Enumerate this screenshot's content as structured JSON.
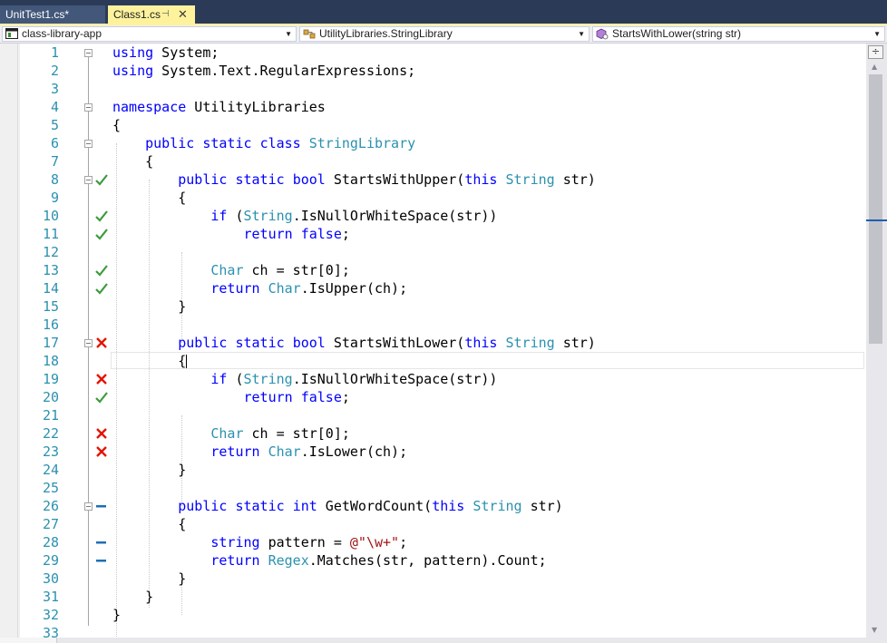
{
  "tabs": [
    {
      "label": "UnitTest1.cs*",
      "active": false
    },
    {
      "label": "Class1.cs",
      "active": true,
      "pin": "⊣",
      "close": "✕"
    }
  ],
  "nav": {
    "project": "class-library-app",
    "type": "UtilityLibraries.StringLibrary",
    "member": "StartsWithLower(string str)"
  },
  "colors": {
    "keyword": "#0000ff",
    "type": "#2b91af",
    "string": "#a31515",
    "line_number": "#2b91af",
    "covered": "#3c9b3c",
    "not_covered": "#e51400",
    "no_coverage": "#1e6fb4",
    "active_tab": "#fff29d"
  },
  "scroll": {
    "split": "÷"
  },
  "lines": [
    {
      "n": "1",
      "code": "using System;",
      "fold": true,
      "cov": "none"
    },
    {
      "n": "2",
      "code": "using System.Text.RegularExpressions;",
      "fold": false,
      "cov": "none"
    },
    {
      "n": "3",
      "code": "",
      "fold": false,
      "cov": "none"
    },
    {
      "n": "4",
      "code": "namespace UtilityLibraries",
      "fold": true,
      "cov": "none"
    },
    {
      "n": "5",
      "code": "{",
      "fold": false,
      "cov": "none"
    },
    {
      "n": "6",
      "code": "    public static class StringLibrary",
      "fold": true,
      "cov": "none"
    },
    {
      "n": "7",
      "code": "    {",
      "fold": false,
      "cov": "none"
    },
    {
      "n": "8",
      "code": "        public static bool StartsWithUpper(this String str)",
      "fold": true,
      "cov": "covered"
    },
    {
      "n": "9",
      "code": "        {",
      "fold": false,
      "cov": "none"
    },
    {
      "n": "10",
      "code": "            if (String.IsNullOrWhiteSpace(str))",
      "fold": false,
      "cov": "covered"
    },
    {
      "n": "11",
      "code": "                return false;",
      "fold": false,
      "cov": "covered"
    },
    {
      "n": "12",
      "code": "",
      "fold": false,
      "cov": "none"
    },
    {
      "n": "13",
      "code": "            Char ch = str[0];",
      "fold": false,
      "cov": "covered"
    },
    {
      "n": "14",
      "code": "            return Char.IsUpper(ch);",
      "fold": false,
      "cov": "covered"
    },
    {
      "n": "15",
      "code": "        }",
      "fold": false,
      "cov": "none"
    },
    {
      "n": "16",
      "code": "",
      "fold": false,
      "cov": "none"
    },
    {
      "n": "17",
      "code": "        public static bool StartsWithLower(this String str)",
      "fold": true,
      "cov": "not-covered"
    },
    {
      "n": "18",
      "code": "        {",
      "fold": false,
      "cov": "none"
    },
    {
      "n": "19",
      "code": "            if (String.IsNullOrWhiteSpace(str))",
      "fold": false,
      "cov": "not-covered"
    },
    {
      "n": "20",
      "code": "                return false;",
      "fold": false,
      "cov": "covered"
    },
    {
      "n": "21",
      "code": "",
      "fold": false,
      "cov": "none"
    },
    {
      "n": "22",
      "code": "            Char ch = str[0];",
      "fold": false,
      "cov": "not-covered"
    },
    {
      "n": "23",
      "code": "            return Char.IsLower(ch);",
      "fold": false,
      "cov": "not-covered"
    },
    {
      "n": "24",
      "code": "        }",
      "fold": false,
      "cov": "none"
    },
    {
      "n": "25",
      "code": "",
      "fold": false,
      "cov": "none"
    },
    {
      "n": "26",
      "code": "        public static int GetWordCount(this String str)",
      "fold": true,
      "cov": "no-coverage"
    },
    {
      "n": "27",
      "code": "        {",
      "fold": false,
      "cov": "none"
    },
    {
      "n": "28",
      "code": "            string pattern = @\"\\w+\";",
      "fold": false,
      "cov": "no-coverage"
    },
    {
      "n": "29",
      "code": "            return Regex.Matches(str, pattern).Count;",
      "fold": false,
      "cov": "no-coverage"
    },
    {
      "n": "30",
      "code": "        }",
      "fold": false,
      "cov": "none"
    },
    {
      "n": "31",
      "code": "    }",
      "fold": false,
      "cov": "none"
    },
    {
      "n": "32",
      "code": "}",
      "fold": false,
      "cov": "none"
    },
    {
      "n": "33",
      "code": "",
      "fold": false,
      "cov": "none"
    }
  ]
}
